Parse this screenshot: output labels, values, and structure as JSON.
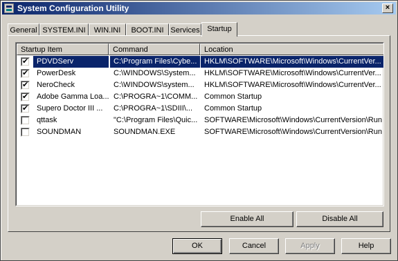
{
  "window": {
    "title": "System Configuration Utility",
    "close_glyph": "×"
  },
  "tabs": [
    "General",
    "SYSTEM.INI",
    "WIN.INI",
    "BOOT.INI",
    "Services",
    "Startup"
  ],
  "active_tab": "Startup",
  "table": {
    "columns": [
      "Startup Item",
      "Command",
      "Location"
    ],
    "rows": [
      {
        "checked": true,
        "item": "PDVDServ",
        "command": "C:\\Program Files\\Cybe...",
        "location": "HKLM\\SOFTWARE\\Microsoft\\Windows\\CurrentVer..."
      },
      {
        "checked": true,
        "item": "PowerDesk",
        "command": "C:\\WINDOWS\\System...",
        "location": "HKLM\\SOFTWARE\\Microsoft\\Windows\\CurrentVer..."
      },
      {
        "checked": true,
        "item": "NeroCheck",
        "command": "C:\\WINDOWS\\system...",
        "location": "HKLM\\SOFTWARE\\Microsoft\\Windows\\CurrentVer..."
      },
      {
        "checked": true,
        "item": "Adobe Gamma Loa...",
        "command": "C:\\PROGRA~1\\COMM...",
        "location": "Common Startup"
      },
      {
        "checked": true,
        "item": "Supero Doctor III ...",
        "command": "C:\\PROGRA~1\\SDIII\\...",
        "location": "Common Startup"
      },
      {
        "checked": false,
        "item": "qttask",
        "command": "\"C:\\Program Files\\Quic...",
        "location": "SOFTWARE\\Microsoft\\Windows\\CurrentVersion\\Run"
      },
      {
        "checked": false,
        "item": "SOUNDMAN",
        "command": "SOUNDMAN.EXE",
        "location": "SOFTWARE\\Microsoft\\Windows\\CurrentVersion\\Run"
      }
    ],
    "selected_row": 0
  },
  "buttons": {
    "enable_all_label": "Enable All",
    "disable_all_label": "Disable All",
    "ok_label": "OK",
    "cancel_label": "Cancel",
    "apply_label": "Apply",
    "apply_enabled": false,
    "help_label": "Help"
  },
  "colors": {
    "selection": "#0a246a",
    "face": "#d4d0c8",
    "title_start": "#0a246a",
    "title_end": "#a6caf0"
  }
}
